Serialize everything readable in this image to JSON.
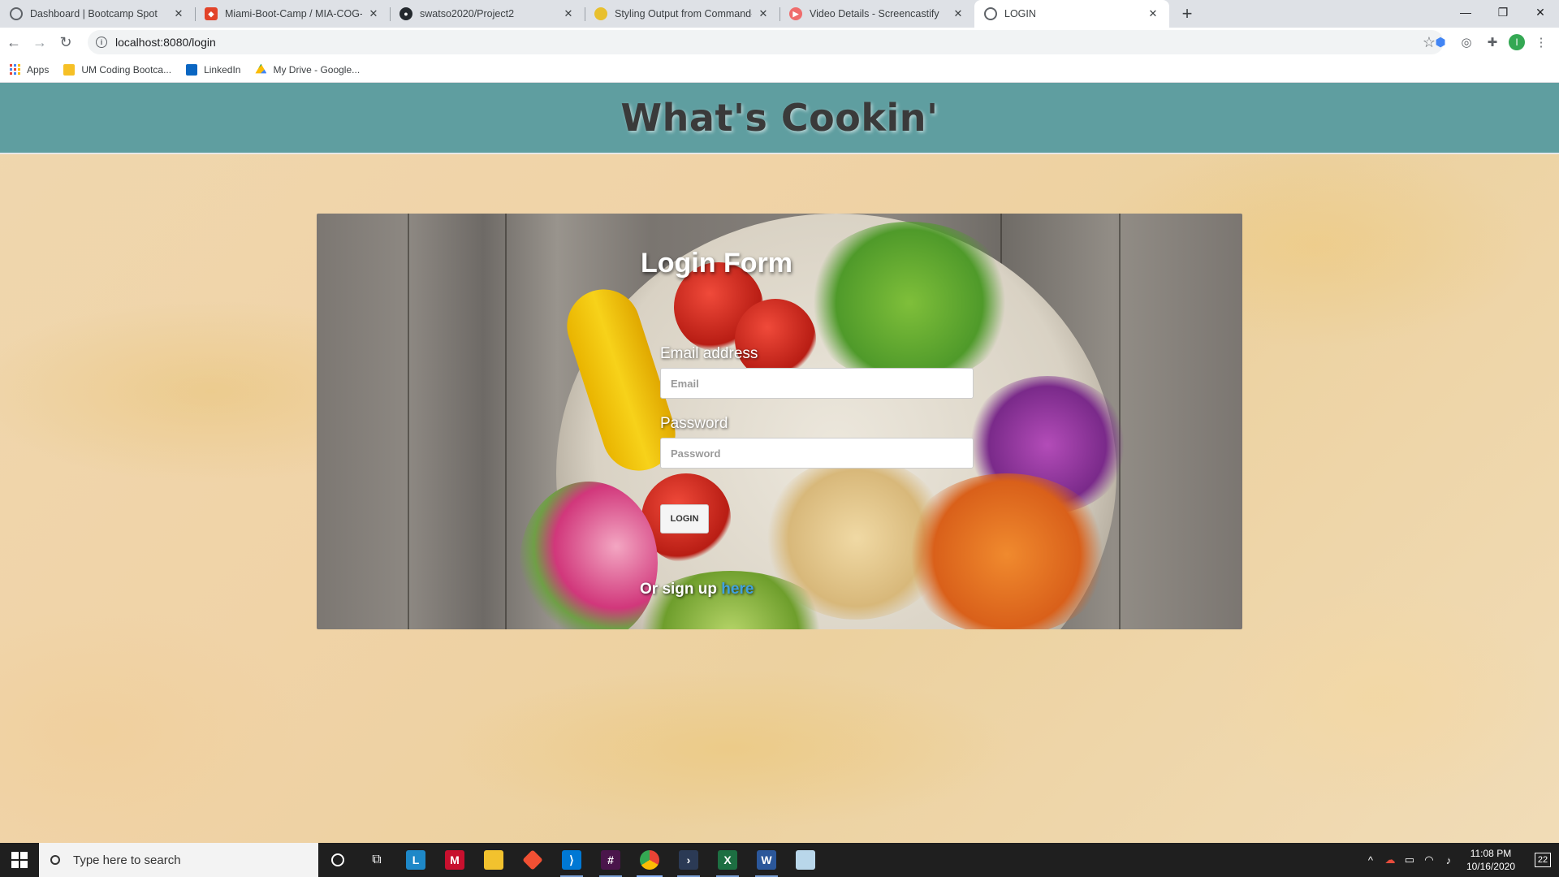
{
  "browser": {
    "tabs": [
      {
        "title": "Dashboard | Bootcamp Spot",
        "favicon": "globe-icon",
        "color": "#5f6368",
        "active": false
      },
      {
        "title": "Miami-Boot-Camp / MIA-COG-F",
        "favicon": "gitlab-icon",
        "color": "#e24329",
        "active": false
      },
      {
        "title": "swatso2020/Project2",
        "favicon": "github-icon",
        "color": "#24292e",
        "active": false
      },
      {
        "title": "Styling Output from Command-l",
        "favicon": "chalk-icon",
        "color": "#e8c02e",
        "active": false
      },
      {
        "title": "Video Details - Screencastify",
        "favicon": "screencastify-icon",
        "color": "#ef6c6c",
        "active": false
      },
      {
        "title": "LOGIN",
        "favicon": "globe-icon",
        "color": "#5f6368",
        "active": true
      }
    ],
    "url": "localhost:8080/login",
    "bookmarks": [
      "Apps",
      "UM Coding Bootca...",
      "LinkedIn",
      "My Drive - Google..."
    ]
  },
  "site": {
    "title": "What's Cookin'"
  },
  "login": {
    "title": "Login Form",
    "email_label": "Email address",
    "email_placeholder": "Email",
    "password_label": "Password",
    "password_placeholder": "Password",
    "button_label": "LOGIN",
    "signup_text": "Or sign up ",
    "signup_link": "here"
  },
  "taskbar": {
    "search_placeholder": "Type here to search",
    "time": "11:08 PM",
    "date": "10/16/2020",
    "notification_count": "22"
  },
  "colors": {
    "header": "#5f9ea0",
    "link": "#3fa1e0"
  }
}
